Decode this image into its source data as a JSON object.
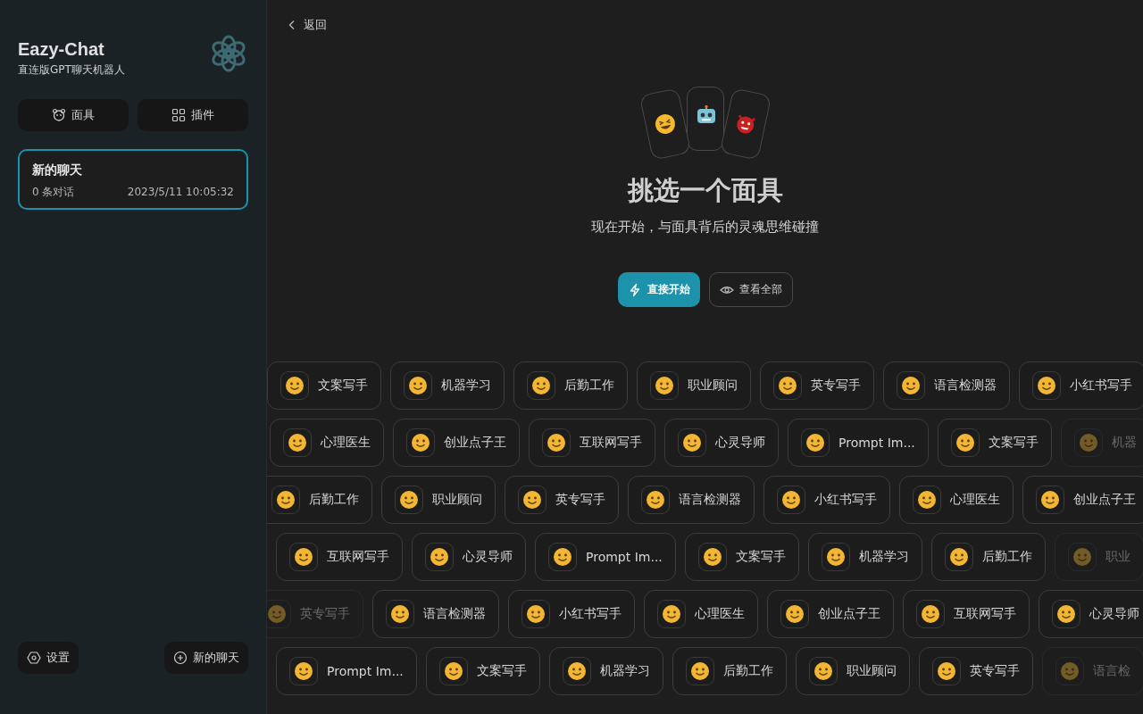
{
  "sidebar": {
    "title": "Eazy-Chat",
    "subtitle": "直连版GPT聊天机器人",
    "tabs": [
      {
        "label": "面具",
        "kind": "mask"
      },
      {
        "label": "插件",
        "kind": "plugin"
      }
    ],
    "chats": [
      {
        "title": "新的聊天",
        "count": "0 条对话",
        "time": "2023/5/11 10:05:32",
        "selected": true
      }
    ],
    "footer_buttons": [
      {
        "label": "设置",
        "kind": "settings"
      },
      {
        "label": "新的聊天",
        "kind": "new"
      }
    ]
  },
  "main": {
    "back": "返回",
    "title": "挑选一个面具",
    "subtitle": "现在开始，与面具背后的灵魂思维碰撞",
    "actions": [
      {
        "label": "直接开始",
        "kind": "primary"
      },
      {
        "label": "查看全部",
        "kind": "secondary"
      }
    ],
    "mask_rows": [
      [
        {
          "label": "文案写手",
          "faded": false
        },
        {
          "label": "机器学习",
          "faded": false
        },
        {
          "label": "后勤工作",
          "faded": false
        },
        {
          "label": "职业顾问",
          "faded": false
        },
        {
          "label": "英专写手",
          "faded": false
        },
        {
          "label": "语言检测器",
          "faded": false
        },
        {
          "label": "小红书写手",
          "faded": false
        }
      ],
      [
        {
          "label": "心理医生",
          "faded": false
        },
        {
          "label": "创业点子王",
          "faded": false
        },
        {
          "label": "互联网写手",
          "faded": false
        },
        {
          "label": "心灵导师",
          "faded": false
        },
        {
          "label": "Prompt Im...",
          "faded": false
        },
        {
          "label": "文案写手",
          "faded": false
        },
        {
          "label": "机器",
          "faded": true
        }
      ],
      [
        {
          "label": "后勤工作",
          "faded": false
        },
        {
          "label": "职业顾问",
          "faded": false
        },
        {
          "label": "英专写手",
          "faded": false
        },
        {
          "label": "语言检测器",
          "faded": false
        },
        {
          "label": "小红书写手",
          "faded": false
        },
        {
          "label": "心理医生",
          "faded": false
        },
        {
          "label": "创业点子王",
          "faded": false
        }
      ],
      [
        {
          "label": "互联网写手",
          "faded": false
        },
        {
          "label": "心灵导师",
          "faded": false
        },
        {
          "label": "Prompt Im...",
          "faded": false
        },
        {
          "label": "文案写手",
          "faded": false
        },
        {
          "label": "机器学习",
          "faded": false
        },
        {
          "label": "后勤工作",
          "faded": false
        },
        {
          "label": "职业",
          "faded": true
        }
      ],
      [
        {
          "label": "英专写手",
          "faded": true
        },
        {
          "label": "语言检测器",
          "faded": false
        },
        {
          "label": "小红书写手",
          "faded": false
        },
        {
          "label": "心理医生",
          "faded": false
        },
        {
          "label": "创业点子王",
          "faded": false
        },
        {
          "label": "互联网写手",
          "faded": false
        },
        {
          "label": "心灵导师",
          "faded": false
        }
      ],
      [
        {
          "label": "Prompt Im...",
          "faded": false
        },
        {
          "label": "文案写手",
          "faded": false
        },
        {
          "label": "机器学习",
          "faded": false
        },
        {
          "label": "后勤工作",
          "faded": false
        },
        {
          "label": "职业顾问",
          "faded": false
        },
        {
          "label": "英专写手",
          "faded": false
        },
        {
          "label": "语言检",
          "faded": true
        }
      ]
    ]
  }
}
